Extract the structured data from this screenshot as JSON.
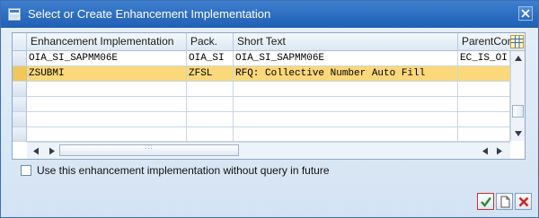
{
  "window": {
    "title": "Select or Create Enhancement Implementation"
  },
  "table": {
    "columns": [
      "Enhancement Implementation",
      "Pack.",
      "Short Text",
      "ParentCon"
    ],
    "rows": [
      [
        "OIA_SI_SAPMM06E",
        "OIA_SI",
        "OIA_SI_SAPMM06E",
        "EC_IS_OI"
      ],
      [
        "ZSUBMI",
        "ZFSL",
        "RFQ: Collective Number Auto Fill",
        ""
      ]
    ],
    "selected_row_index": 1,
    "highlight_color": "#fbd87a"
  },
  "options": {
    "no_query_label": "Use this enhancement implementation without query in future",
    "no_query_checked": false
  },
  "icons": {
    "title": "sap-window-icon",
    "close": "close-icon",
    "config": "table-config-icon",
    "ok": "checkmark-icon",
    "create": "new-document-icon",
    "cancel": "cancel-x-icon"
  }
}
